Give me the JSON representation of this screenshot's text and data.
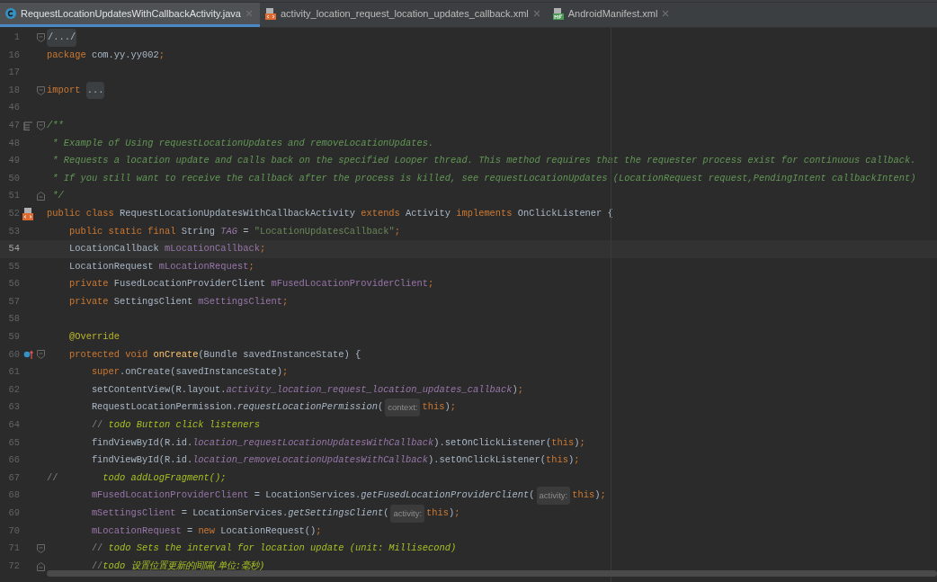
{
  "tabs": [
    {
      "label": "RequestLocationUpdatesWithCallbackActivity.java",
      "kind": "java",
      "selected": true
    },
    {
      "label": "activity_location_request_location_updates_callback.xml",
      "kind": "layout",
      "selected": false
    },
    {
      "label": "AndroidManifest.xml",
      "kind": "manifest",
      "selected": false
    }
  ],
  "lines": [
    {
      "number": "1",
      "current": false,
      "fold": {
        "kind": "start"
      },
      "tokens": [
        {
          "kind": "folded",
          "text": "/.../"
        }
      ]
    },
    {
      "number": "16",
      "current": false,
      "tokens": [
        {
          "kind": "kw",
          "text": "package"
        },
        {
          "kind": "plain",
          "text": " com.yy.yy002"
        },
        {
          "kind": "kw",
          "text": ";"
        }
      ]
    },
    {
      "number": "17",
      "current": false
    },
    {
      "number": "18",
      "current": false,
      "fold": {
        "kind": "start"
      },
      "tokens": [
        {
          "kind": "kw",
          "text": "import "
        },
        {
          "kind": "folded",
          "text": "..."
        }
      ]
    },
    {
      "number": "46",
      "current": false
    },
    {
      "number": "47",
      "current": false,
      "marker": {
        "kind": "doc"
      },
      "fold": {
        "kind": "start"
      },
      "tokens": [
        {
          "kind": "doc",
          "text": "/**"
        }
      ]
    },
    {
      "number": "48",
      "current": false,
      "tokens": [
        {
          "kind": "doc",
          "text": " * Example of Using requestLocationUpdates and removeLocationUpdates."
        }
      ]
    },
    {
      "number": "49",
      "current": false,
      "tokens": [
        {
          "kind": "doc",
          "text": " * Requests a location update and calls back on the specified Looper thread. This method requires that the requester process exist for continuous callback."
        }
      ]
    },
    {
      "number": "50",
      "current": false,
      "tokens": [
        {
          "kind": "doc",
          "text": " * If you still want to receive the callback after the process is killed, see requestLocationUpdates (LocationRequest request,PendingIntent callbackIntent)"
        }
      ]
    },
    {
      "number": "51",
      "current": false,
      "fold": {
        "kind": "end"
      },
      "tokens": [
        {
          "kind": "doc",
          "text": " */"
        }
      ]
    },
    {
      "number": "52",
      "current": false,
      "marker": {
        "kind": "layout"
      },
      "tokens": [
        {
          "kind": "kw",
          "text": "public class "
        },
        {
          "kind": "plain",
          "text": "RequestLocationUpdatesWithCallbackActivity "
        },
        {
          "kind": "kw",
          "text": "extends "
        },
        {
          "kind": "plain",
          "text": "Activity "
        },
        {
          "kind": "kw",
          "text": "implements "
        },
        {
          "kind": "plain",
          "text": "OnClickListener {"
        }
      ]
    },
    {
      "number": "53",
      "current": false,
      "tokens": [
        {
          "kind": "kw",
          "text": "    public static final "
        },
        {
          "kind": "plain",
          "text": "String "
        },
        {
          "kind": "field_italic",
          "text": "TAG"
        },
        {
          "kind": "plain",
          "text": " = "
        },
        {
          "kind": "string",
          "text": "\"LocationUpdatesCallback\""
        },
        {
          "kind": "kw",
          "text": ";"
        }
      ]
    },
    {
      "number": "54",
      "current": true,
      "tokens": [
        {
          "kind": "plain",
          "text": "    LocationCallback "
        },
        {
          "kind": "field",
          "text": "mLocationCallback"
        },
        {
          "kind": "kw",
          "text": ";"
        }
      ]
    },
    {
      "number": "55",
      "current": false,
      "tokens": [
        {
          "kind": "plain",
          "text": "    LocationRequest "
        },
        {
          "kind": "field",
          "text": "mLocationRequest"
        },
        {
          "kind": "kw",
          "text": ";"
        }
      ]
    },
    {
      "number": "56",
      "current": false,
      "tokens": [
        {
          "kind": "kw",
          "text": "    private "
        },
        {
          "kind": "plain",
          "text": "FusedLocationProviderClient "
        },
        {
          "kind": "field",
          "text": "mFusedLocationProviderClient"
        },
        {
          "kind": "kw",
          "text": ";"
        }
      ]
    },
    {
      "number": "57",
      "current": false,
      "tokens": [
        {
          "kind": "kw",
          "text": "    private "
        },
        {
          "kind": "plain",
          "text": "SettingsClient "
        },
        {
          "kind": "field",
          "text": "mSettingsClient"
        },
        {
          "kind": "kw",
          "text": ";"
        }
      ]
    },
    {
      "number": "58",
      "current": false
    },
    {
      "number": "59",
      "current": false,
      "tokens": [
        {
          "kind": "annotation",
          "text": "    @Override"
        }
      ]
    },
    {
      "number": "60",
      "current": false,
      "marker": {
        "kind": "override"
      },
      "fold": {
        "kind": "start"
      },
      "tokens": [
        {
          "kind": "kw",
          "text": "    protected void "
        },
        {
          "kind": "method",
          "text": "onCreate"
        },
        {
          "kind": "plain",
          "text": "(Bundle savedInstanceState) {"
        }
      ]
    },
    {
      "number": "61",
      "current": false,
      "tokens": [
        {
          "kind": "kw",
          "text": "        super"
        },
        {
          "kind": "plain",
          "text": ".onCreate(savedInstanceState)"
        },
        {
          "kind": "kw",
          "text": ";"
        }
      ]
    },
    {
      "number": "62",
      "current": false,
      "tokens": [
        {
          "kind": "plain",
          "text": "        setContentView(R.layout."
        },
        {
          "kind": "field_italic",
          "text": "activity_location_request_location_updates_callback"
        },
        {
          "kind": "plain",
          "text": ")"
        },
        {
          "kind": "kw",
          "text": ";"
        }
      ]
    },
    {
      "number": "63",
      "current": false,
      "tokens": [
        {
          "kind": "plain",
          "text": "        RequestLocationPermission."
        },
        {
          "kind": "static_call",
          "text": "requestLocationPermission"
        },
        {
          "kind": "plain",
          "text": "("
        },
        {
          "kind": "hint",
          "text": "context:"
        },
        {
          "kind": "kw",
          "text": "this"
        },
        {
          "kind": "plain",
          "text": ")"
        },
        {
          "kind": "kw",
          "text": ";"
        }
      ]
    },
    {
      "number": "64",
      "current": false,
      "tokens": [
        {
          "kind": "comment",
          "text": "        // "
        },
        {
          "kind": "todo",
          "text": "todo Button click listeners"
        }
      ]
    },
    {
      "number": "65",
      "current": false,
      "tokens": [
        {
          "kind": "plain",
          "text": "        findViewById(R.id."
        },
        {
          "kind": "field_italic",
          "text": "location_requestLocationUpdatesWithCallback"
        },
        {
          "kind": "plain",
          "text": ").setOnClickListener("
        },
        {
          "kind": "kw",
          "text": "this"
        },
        {
          "kind": "plain",
          "text": ")"
        },
        {
          "kind": "kw",
          "text": ";"
        }
      ]
    },
    {
      "number": "66",
      "current": false,
      "tokens": [
        {
          "kind": "plain",
          "text": "        findViewById(R.id."
        },
        {
          "kind": "field_italic",
          "text": "location_removeLocationUpdatesWithCallback"
        },
        {
          "kind": "plain",
          "text": ").setOnClickListener("
        },
        {
          "kind": "kw",
          "text": "this"
        },
        {
          "kind": "plain",
          "text": ")"
        },
        {
          "kind": "kw",
          "text": ";"
        }
      ]
    },
    {
      "number": "67",
      "current": false,
      "tokens": [
        {
          "kind": "comment",
          "text": "//        "
        },
        {
          "kind": "todo",
          "text": "todo addLogFragment();"
        }
      ]
    },
    {
      "number": "68",
      "current": false,
      "tokens": [
        {
          "kind": "field",
          "text": "        mFusedLocationProviderClient"
        },
        {
          "kind": "plain",
          "text": " = LocationServices."
        },
        {
          "kind": "static_call",
          "text": "getFusedLocationProviderClient"
        },
        {
          "kind": "plain",
          "text": "("
        },
        {
          "kind": "hint",
          "text": "activity:"
        },
        {
          "kind": "kw",
          "text": "this"
        },
        {
          "kind": "plain",
          "text": ")"
        },
        {
          "kind": "kw",
          "text": ";"
        }
      ]
    },
    {
      "number": "69",
      "current": false,
      "tokens": [
        {
          "kind": "field",
          "text": "        mSettingsClient"
        },
        {
          "kind": "plain",
          "text": " = LocationServices."
        },
        {
          "kind": "static_call",
          "text": "getSettingsClient"
        },
        {
          "kind": "plain",
          "text": "("
        },
        {
          "kind": "hint",
          "text": "activity:"
        },
        {
          "kind": "kw",
          "text": "this"
        },
        {
          "kind": "plain",
          "text": ")"
        },
        {
          "kind": "kw",
          "text": ";"
        }
      ]
    },
    {
      "number": "70",
      "current": false,
      "tokens": [
        {
          "kind": "field",
          "text": "        mLocationRequest"
        },
        {
          "kind": "plain",
          "text": " = "
        },
        {
          "kind": "kw",
          "text": "new "
        },
        {
          "kind": "plain",
          "text": "LocationRequest()"
        },
        {
          "kind": "kw",
          "text": ";"
        }
      ]
    },
    {
      "number": "71",
      "current": false,
      "fold": {
        "kind": "start"
      },
      "tokens": [
        {
          "kind": "comment",
          "text": "        // "
        },
        {
          "kind": "todo",
          "text": "todo Sets the interval for location update (unit: Millisecond)"
        }
      ]
    },
    {
      "number": "72",
      "current": false,
      "fold": {
        "kind": "end"
      },
      "tokens": [
        {
          "kind": "comment",
          "text": "        //"
        },
        {
          "kind": "todo",
          "text": "todo 设置位置更新的间隔(单位:毫秒)"
        }
      ]
    }
  ]
}
